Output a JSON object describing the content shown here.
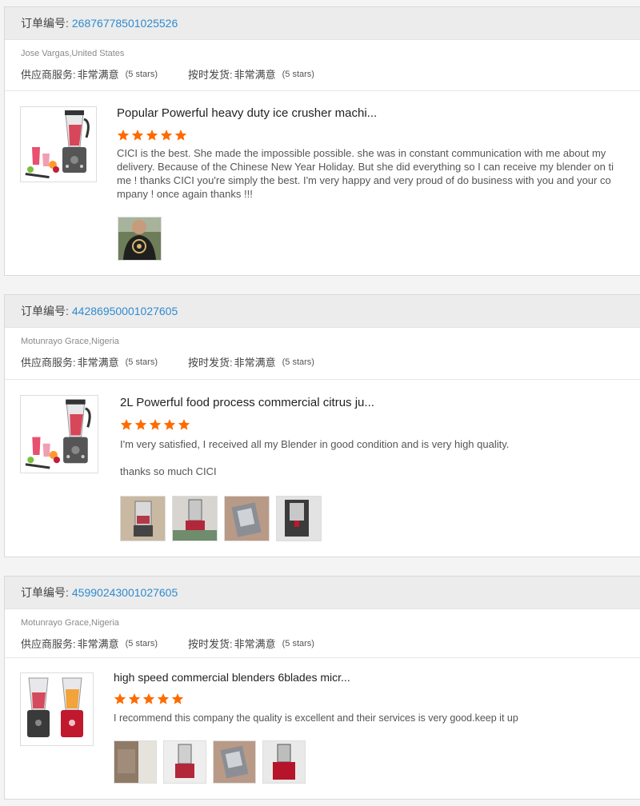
{
  "orders": [
    {
      "order_label": "订单编号:",
      "order_no": "26876778501025526",
      "buyer": "Jose Vargas,United States",
      "service_label": "供应商服务:",
      "service_value": "非常满意",
      "service_stars": "(5 stars)",
      "ship_label": "按时发货:",
      "ship_value": "非常满意",
      "ship_stars": "(5 stars)",
      "product_title": "Popular Powerful heavy duty ice crusher machi...",
      "rating": 5,
      "review_lines": [
        "CICI is the best. She made the impossible possible. she was in constant communication with me about my delivery. Because of the Chinese New Year Holiday. But she did everything so I can receive my blender on ti me ! thanks CICI you're simply the best. I'm very happy and very proud of do business with you and your co mpany ! once again thanks !!!"
      ],
      "photo_count": 1
    },
    {
      "order_label": "订单编号:",
      "order_no": "44286950001027605",
      "buyer": "Motunrayo Grace,Nigeria",
      "service_label": "供应商服务:",
      "service_value": "非常满意",
      "service_stars": "(5 stars)",
      "ship_label": "按时发货:",
      "ship_value": "非常满意",
      "ship_stars": "(5 stars)",
      "product_title": "2L Powerful food process commercial citrus ju...",
      "rating": 5,
      "review_lines": [
        "I'm very satisfied, I received all my Blender in good condition and is very high quality.",
        "thanks so much CICI"
      ],
      "photo_count": 4
    },
    {
      "order_label": "订单编号:",
      "order_no": "45990243001027605",
      "buyer": "Motunrayo Grace,Nigeria",
      "service_label": "供应商服务:",
      "service_value": "非常满意",
      "service_stars": "(5 stars)",
      "ship_label": "按时发货:",
      "ship_value": "非常满意",
      "ship_stars": "(5 stars)",
      "product_title": "high speed commercial blenders 6blades micr...",
      "rating": 5,
      "review_lines": [
        "I recommend this company the quality is excellent and their services is very good.keep it up"
      ],
      "photo_count": 4
    }
  ],
  "colors": {
    "star": "#ff6a00",
    "order_link": "#2e8bcf",
    "header_bg": "#ececec"
  },
  "icons": {
    "star": "star-icon"
  }
}
